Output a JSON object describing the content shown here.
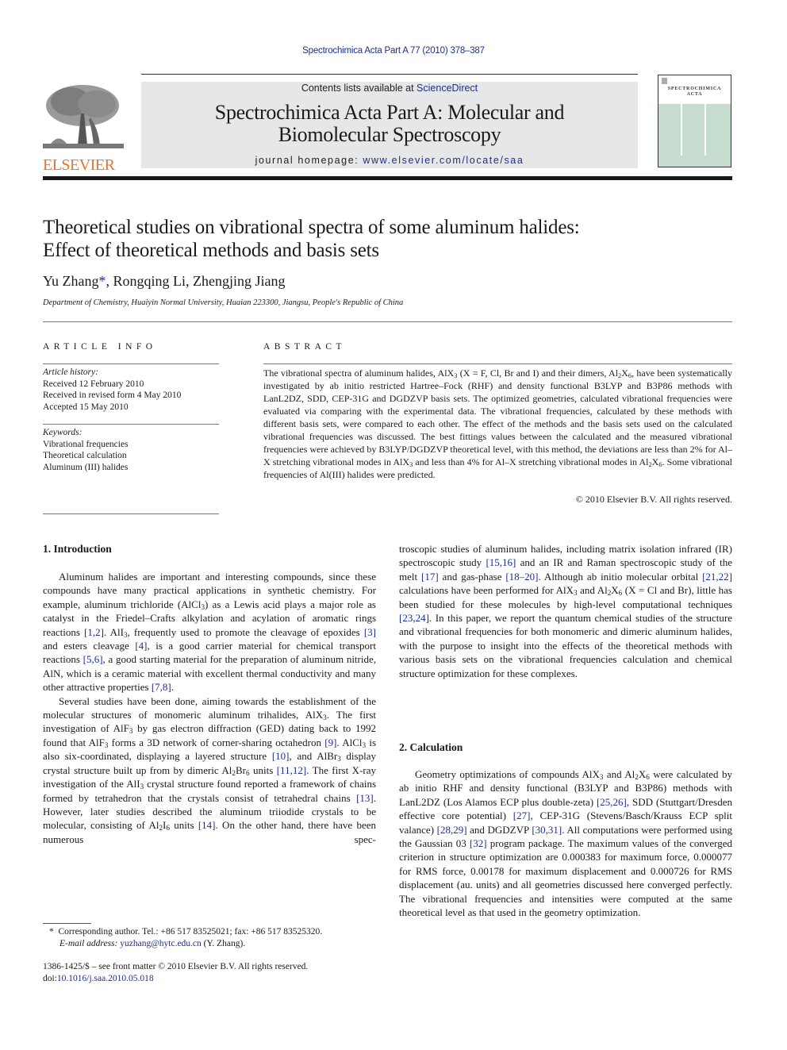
{
  "header": {
    "citation": "Spectrochimica Acta Part A 77 (2010) 378–387",
    "contents_prefix": "Contents lists available at ",
    "contents_link": "ScienceDirect",
    "journal_title_line1": "Spectrochimica Acta Part A: Molecular and",
    "journal_title_line2": "Biomolecular Spectroscopy",
    "homepage_prefix": "journal homepage: ",
    "homepage_link": "www.elsevier.com/locate/saa",
    "publisher_logo_text": "ELSEVIER",
    "cover_title_line1": "SPECTROCHIMICA",
    "cover_title_line2": "ACTA"
  },
  "article": {
    "title_line1": "Theoretical studies on vibrational spectra of some aluminum halides:",
    "title_line2": "Effect of theoretical methods and basis sets",
    "authors": [
      {
        "name": "Yu Zhang",
        "mark": "*"
      },
      {
        "name": ", Rongqing Li, Zhengjing Jiang",
        "mark": ""
      }
    ],
    "affiliation": "Department of Chemistry, Huaiyin Normal University, Huaian 223300, Jiangsu, People's Republic of China"
  },
  "article_info": {
    "label": "ARTICLE INFO",
    "history_header": "Article history:",
    "history": [
      "Received 12 February 2010",
      "Received in revised form 4 May 2010",
      "Accepted 15 May 2010"
    ],
    "keywords_header": "Keywords:",
    "keywords": [
      "Vibrational frequencies",
      "Theoretical calculation",
      "Aluminum (III) halides"
    ]
  },
  "abstract": {
    "label": "ABSTRACT",
    "text_parts": [
      "The vibrational spectra of aluminum halides, AlX",
      "3",
      " (X = F, Cl, Br and I) and their dimers, Al",
      "2",
      "X",
      "6",
      ", have been systematically investigated by ab initio restricted Hartree–Fock (RHF) and density functional B3LYP and B3P86 methods with LanL2DZ, SDD, CEP-31G and DGDZVP basis sets. The optimized geometries, calculated vibrational frequencies were evaluated via comparing with the experimental data. The vibrational frequencies, calculated by these methods with different basis sets, were compared to each other. The effect of the methods and the basis sets used on the calculated vibrational frequencies was discussed. The best fittings values between the calculated and the measured vibrational frequencies were achieved by B3LYP/DGDZVP theoretical level, with this method, the deviations are less than 2% for Al–X stretching vibrational modes in AlX",
      "3",
      " and less than 4% for Al–X stretching vibrational modes in Al",
      "2",
      "X",
      "6",
      ". Some vibrational frequencies of Al(III) halides were predicted."
    ],
    "copyright": "© 2010 Elsevier B.V. All rights reserved."
  },
  "sections": {
    "intro_heading": "1.  Introduction",
    "calc_heading": "2.  Calculation"
  },
  "body": {
    "p1": [
      {
        "t": "Aluminum halides are important and interesting compounds, since these compounds have many practical applications in synthetic chemistry. For example, aluminum trichloride (AlCl"
      },
      {
        "sub": "3"
      },
      {
        "t": ") as a Lewis acid plays a major role as catalyst in the Friedel–Crafts alkylation and acylation of aromatic rings reactions "
      },
      {
        "ref": "[1,2]"
      },
      {
        "t": ". AlI"
      },
      {
        "sub": "3"
      },
      {
        "t": ", frequently used to promote the cleavage of epoxides "
      },
      {
        "ref": "[3]"
      },
      {
        "t": " and esters cleavage "
      },
      {
        "ref": "[4]"
      },
      {
        "t": ", is a good carrier material for chemical transport reactions "
      },
      {
        "ref": "[5,6]"
      },
      {
        "t": ", a good starting material for the preparation of aluminum nitride, AlN, which is a ceramic material with excellent thermal conductivity and many other attractive properties "
      },
      {
        "ref": "[7,8]"
      },
      {
        "t": "."
      }
    ],
    "p2": [
      {
        "t": "Several studies have been done, aiming towards the establishment of the molecular structures of monomeric aluminum trihalides, AlX"
      },
      {
        "sub": "3"
      },
      {
        "t": ". The first investigation of AlF"
      },
      {
        "sub": "3"
      },
      {
        "t": " by gas electron diffraction (GED) dating back to 1992 found that AlF"
      },
      {
        "sub": "3"
      },
      {
        "t": " forms a 3D network of corner-sharing octahedron "
      },
      {
        "ref": "[9]"
      },
      {
        "t": ". AlCl"
      },
      {
        "sub": "3"
      },
      {
        "t": " is also six-coordinated, displaying a layered structure "
      },
      {
        "ref": "[10]"
      },
      {
        "t": ", and AlBr"
      },
      {
        "sub": "3"
      },
      {
        "t": " display crystal structure built up from by dimeric Al"
      },
      {
        "sub": "2"
      },
      {
        "t": "Br"
      },
      {
        "sub": "6"
      },
      {
        "t": " units "
      },
      {
        "ref": "[11,12]"
      },
      {
        "t": ". The first X-ray investigation of the AlI"
      },
      {
        "sub": "3"
      },
      {
        "t": " crystal structure found reported a framework of chains formed by tetrahedron that the crystals consist of tetrahedral chains "
      },
      {
        "ref": "[13]"
      },
      {
        "t": ". However, later studies described the aluminum triiodide crystals to be molecular, consisting of Al"
      },
      {
        "sub": "2"
      },
      {
        "t": "I"
      },
      {
        "sub": "6"
      },
      {
        "t": " units "
      },
      {
        "ref": "[14]"
      },
      {
        "t": ". On the other hand, there have been numerous spectroscopic studies of aluminum halides, including matrix isolation infrared (IR) spectroscopic study "
      },
      {
        "ref": "[15,16]"
      },
      {
        "t": " and an IR and Raman spectroscopic study of the melt "
      },
      {
        "ref": "[17]"
      },
      {
        "t": " and gas-phase "
      },
      {
        "ref": "[18–20]"
      },
      {
        "t": ". Although ab initio molecular orbital "
      },
      {
        "ref": "[21,22]"
      },
      {
        "t": " calculations have been performed for AlX"
      },
      {
        "sub": "3"
      },
      {
        "t": " and Al"
      },
      {
        "sub": "2"
      },
      {
        "t": "X"
      },
      {
        "sub": "6"
      },
      {
        "t": " (X = Cl and Br), little has been studied for these molecules by high-level computational techniques "
      },
      {
        "ref": "[23,24]"
      },
      {
        "t": ". In this paper, we report the quantum chemical studies of the structure and vibrational frequencies for both monomeric and dimeric aluminum halides, with the purpose to insight into the effects of the theoretical methods with various basis sets on the vibrational frequencies calculation and chemical structure optimization for these complexes."
      }
    ],
    "p3": [
      {
        "t": "Geometry optimizations of compounds AlX"
      },
      {
        "sub": "3"
      },
      {
        "t": " and Al"
      },
      {
        "sub": "2"
      },
      {
        "t": "X"
      },
      {
        "sub": "6"
      },
      {
        "t": " were calculated by ab initio RHF and density functional (B3LYP and B3P86) methods with LanL2DZ (Los Alamos ECP plus double-zeta) "
      },
      {
        "ref": "[25,26]"
      },
      {
        "t": ", SDD (Stuttgart/Dresden effective core potential) "
      },
      {
        "ref": "[27]"
      },
      {
        "t": ", CEP-31G (Stevens/Basch/Krauss ECP split valance) "
      },
      {
        "ref": "[28,29]"
      },
      {
        "t": " and DGDZVP "
      },
      {
        "ref": "[30,31]"
      },
      {
        "t": ". All computations were performed using the Gaussian 03 "
      },
      {
        "ref": "[32]"
      },
      {
        "t": " program package. The maximum values of the converged criterion in structure optimization are 0.000383 for maximum force, 0.000077 for RMS force, 0.00178 for maximum displacement and 0.000726 for RMS displacement (au. units) and all geometries discussed here converged perfectly. The vibrational frequencies and intensities were computed at the same theoretical level as that used in the geometry optimization."
      }
    ]
  },
  "footnotes": {
    "corresponding_mark": "*",
    "corresponding": "Corresponding author. Tel.: +86 517 83525021; fax: +86 517 83525320.",
    "email_label": "E-mail address: ",
    "email": "yuzhang@hytc.edu.cn",
    "email_suffix": " (Y. Zhang).",
    "issn": "1386-1425/$ – see front matter © 2010 Elsevier B.V. All rights reserved.",
    "doi_prefix": "doi:",
    "doi": "10.1016/j.saa.2010.05.018"
  },
  "colors": {
    "link": "#1f2e8a",
    "elsevier_orange": "#e2742c",
    "banner_grey": "#e6e7e8",
    "cover_green": "#c6dcce"
  }
}
